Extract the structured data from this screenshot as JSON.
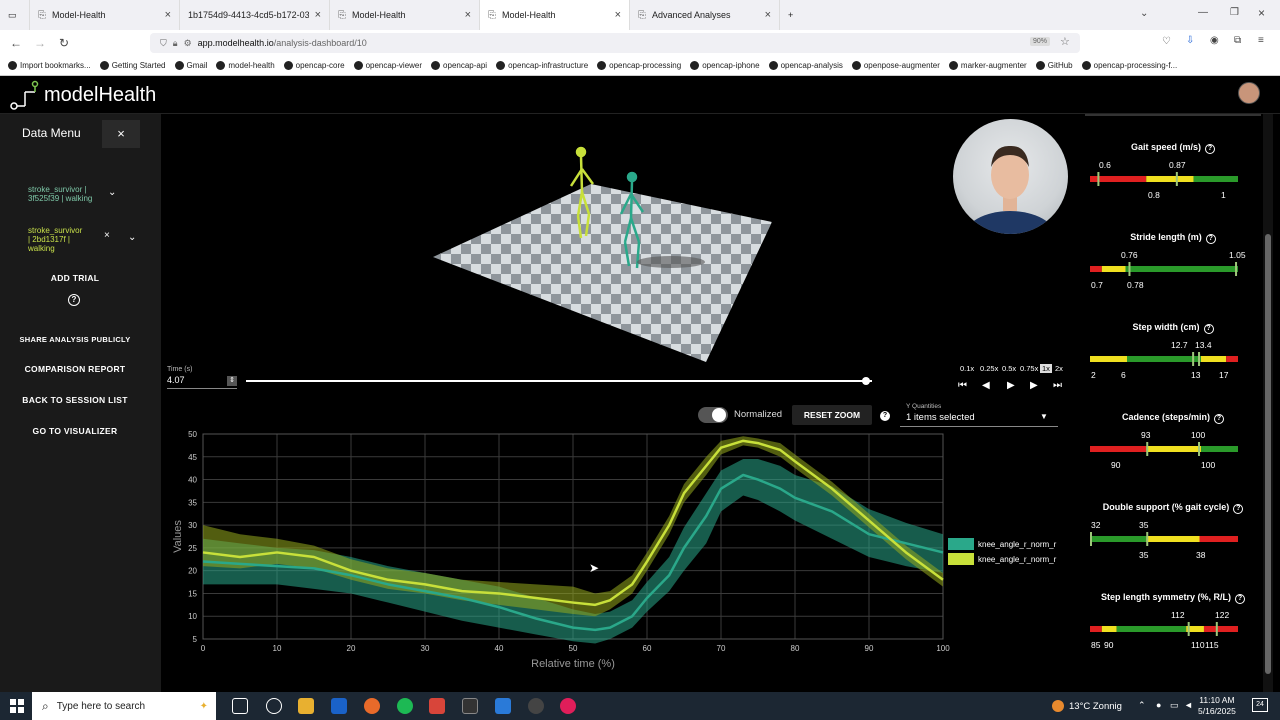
{
  "browser": {
    "tabs": [
      {
        "title": "Model-Health"
      },
      {
        "title": "1b1754d9-4413-4cd5-b172-03"
      },
      {
        "title": "Model-Health"
      },
      {
        "title": "Model-Health"
      },
      {
        "title": "Advanced Analyses"
      }
    ],
    "new_tab_label": "+",
    "url_domain": "app.modelhealth.io",
    "url_path": "/analysis-dashboard/10",
    "zoom": "90%",
    "bookmarks": [
      "Import bookmarks...",
      "Getting Started",
      "Gmail",
      "model-health",
      "opencap-core",
      "opencap-viewer",
      "opencap-api",
      "opencap-infrastructure",
      "opencap-processing",
      "opencap-iphone",
      "opencap-analysis",
      "openpose-augmenter",
      "marker-augmenter",
      "GitHub",
      "opencap-processing-f..."
    ]
  },
  "app": {
    "logo_text": "modelHealth"
  },
  "sidebar": {
    "title": "Data Menu",
    "close_label": "×",
    "trials": [
      {
        "label_line1": "stroke_survivor |",
        "label_line2": "3f525f39 | walking"
      },
      {
        "label_line1": "stroke_survivor",
        "label_line2": "| 2bd1317f |",
        "label_line3": "walking"
      }
    ],
    "add_trial": "ADD TRIAL",
    "help": "?",
    "buttons": [
      "SHARE ANALYSIS PUBLICLY",
      "COMPARISON REPORT",
      "BACK TO SESSION LIST",
      "GO TO VISUALIZER"
    ]
  },
  "player": {
    "time_label": "Time (s)",
    "time_value": "4.07",
    "progress": 0.99,
    "speeds": [
      "0.1x",
      "0.25x",
      "0.5x",
      "0.75x",
      "1x",
      "2x"
    ],
    "selected_speed": "1x"
  },
  "controls": {
    "normalized_label": "Normalized",
    "reset_zoom": "RESET ZOOM",
    "help": "?",
    "y_quantities_label": "Y Quantities",
    "y_quantities_value": "1 items selected"
  },
  "chart_data": {
    "type": "line",
    "xlabel": "Relative time (%)",
    "ylabel": "Values",
    "xlim": [
      0,
      100
    ],
    "ylim": [
      5,
      50
    ],
    "xticks": [
      0,
      10,
      20,
      30,
      40,
      50,
      60,
      70,
      80,
      90,
      100
    ],
    "yticks": [
      5,
      10,
      15,
      20,
      25,
      30,
      35,
      40,
      45,
      50
    ],
    "grid": true,
    "legend": "right",
    "series": [
      {
        "name": "knee_angle_r_norm_r",
        "color": "#2aa88a",
        "x": [
          0,
          5,
          10,
          15,
          20,
          25,
          30,
          35,
          40,
          45,
          50,
          53,
          55,
          58,
          60,
          63,
          65,
          68,
          70,
          73,
          75,
          78,
          80,
          85,
          90,
          95,
          100
        ],
        "mean": [
          22,
          21.5,
          21,
          20.5,
          19,
          17,
          15.5,
          14,
          12,
          9.5,
          7.5,
          7,
          7.5,
          10,
          14,
          19,
          25,
          32,
          38,
          41,
          40,
          38,
          36,
          33,
          28,
          26,
          24
        ],
        "lower": [
          17,
          17,
          17,
          16,
          15,
          13,
          11,
          9,
          7.5,
          6,
          4.5,
          4,
          5,
          7.5,
          11,
          15.5,
          20,
          26,
          33,
          36.5,
          35.5,
          33,
          31,
          27,
          23,
          21,
          19.5
        ],
        "upper": [
          27,
          26,
          25,
          24.5,
          23,
          21,
          19.5,
          18,
          16.5,
          14,
          11.5,
          10.5,
          11,
          13.5,
          17.5,
          23,
          29.5,
          37,
          42,
          44.5,
          44.5,
          43,
          41,
          38.5,
          33.5,
          30.5,
          28
        ]
      },
      {
        "name": "knee_angle_r_norm_r",
        "color": "#c8e03a",
        "x": [
          0,
          5,
          10,
          15,
          20,
          25,
          30,
          35,
          40,
          45,
          50,
          53,
          55,
          58,
          60,
          63,
          65,
          68,
          70,
          73,
          75,
          78,
          80,
          85,
          90,
          95,
          100
        ],
        "mean": [
          24,
          23,
          24,
          23,
          20,
          18,
          17,
          15.5,
          15,
          14,
          13,
          12.5,
          13.5,
          17,
          22,
          30,
          37,
          43,
          47,
          48.5,
          48,
          46.5,
          44,
          38,
          31,
          24,
          18
        ],
        "lower": [
          21,
          20.5,
          21.5,
          20.5,
          18,
          16,
          15,
          13.5,
          12.5,
          11.5,
          10.5,
          10,
          11.5,
          15,
          20,
          28,
          35,
          41,
          45.5,
          47.5,
          47,
          45,
          42.5,
          36.5,
          29.5,
          22.5,
          16.5
        ],
        "upper": [
          30,
          28,
          27,
          25.5,
          22.5,
          20.5,
          19.5,
          18,
          17.5,
          17,
          16.5,
          15,
          15.5,
          19,
          24,
          32,
          39,
          45,
          48.5,
          49.5,
          49,
          48,
          45.5,
          39.5,
          32.5,
          25.5,
          19.5
        ]
      }
    ]
  },
  "metrics": [
    {
      "title": "Gait speed (m/s)",
      "top_labels": [
        "0.6",
        "0.87"
      ],
      "bottom_labels": [
        "0.8",
        "1"
      ]
    },
    {
      "title": "Stride length (m)",
      "top_labels": [
        "0.76",
        "1.05"
      ],
      "bottom_labels": [
        "0.7",
        "0.78"
      ]
    },
    {
      "title": "Step width (cm)",
      "top_labels": [
        "12.7",
        "13.4"
      ],
      "bottom_labels": [
        "2",
        "6",
        "13",
        "17"
      ]
    },
    {
      "title": "Cadence (steps/min)",
      "top_labels": [
        "93",
        "100"
      ],
      "bottom_labels": [
        "90",
        "100"
      ]
    },
    {
      "title": "Double support (% gait cycle)",
      "top_labels": [
        "32",
        "35"
      ],
      "bottom_labels": [
        "35",
        "38"
      ]
    },
    {
      "title": "Step length symmetry (%, R/L)",
      "top_labels": [
        "112",
        "122"
      ],
      "bottom_labels": [
        "85",
        "90",
        "110",
        "115"
      ]
    }
  ],
  "taskbar": {
    "search_placeholder": "Type here to search",
    "weather": "13°C  Zonnig",
    "time": "11:10 AM",
    "date": "5/16/2025",
    "notification_count": "24"
  }
}
